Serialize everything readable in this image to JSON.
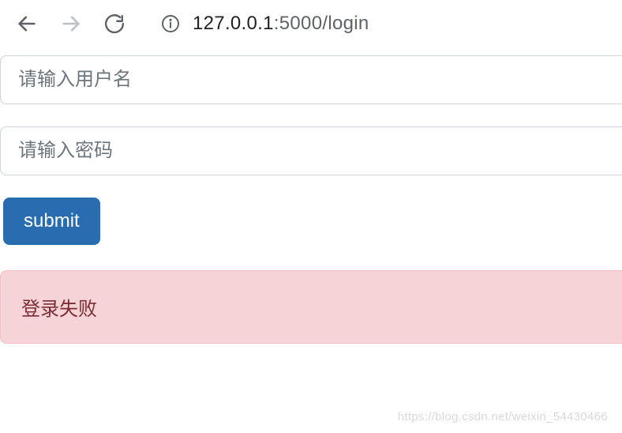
{
  "browser": {
    "url_host": "127.0.0.1",
    "url_port_path": ":5000/login"
  },
  "form": {
    "username_placeholder": "请输入用户名",
    "password_placeholder": "请输入密码",
    "submit_label": "submit"
  },
  "alert": {
    "message": "登录失败"
  },
  "watermark": {
    "text": "https://blog.csdn.net/weixin_54430466"
  }
}
